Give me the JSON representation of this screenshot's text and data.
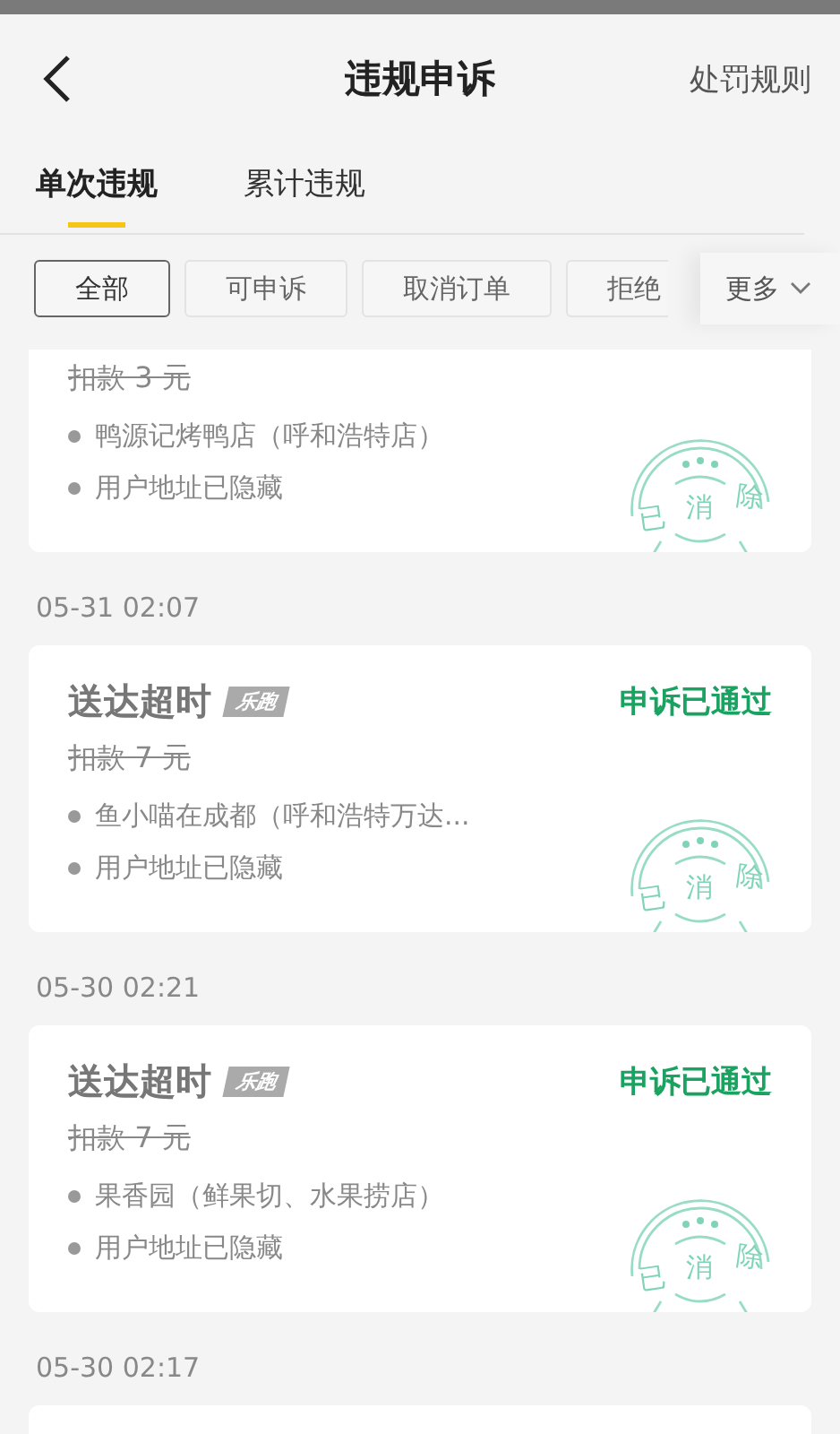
{
  "header": {
    "title": "违规申诉",
    "action": "处罚规则"
  },
  "tabs": [
    {
      "label": "单次违规",
      "selected": true
    },
    {
      "label": "累计违规",
      "selected": false
    }
  ],
  "filters": [
    {
      "label": "全部",
      "selected": true
    },
    {
      "label": "可申诉",
      "selected": false
    },
    {
      "label": "取消订单",
      "selected": false
    },
    {
      "label": "拒绝",
      "selected": false
    }
  ],
  "more": "更多",
  "records": [
    {
      "kind": "partial",
      "fine": "扣款 3 元",
      "shop": "鸭源记烤鸭店（呼和浩特店）",
      "address": "用户地址已隐藏",
      "stamp": "已消除"
    },
    {
      "kind": "full",
      "date": "05-31 02:07",
      "title": "送达超时",
      "tag": "乐跑",
      "status": "申诉已通过",
      "fine": "扣款 7 元",
      "shop": "鱼小喵在成都（呼和浩特万达...",
      "address": "用户地址已隐藏",
      "stamp": "已消除"
    },
    {
      "kind": "full",
      "date": "05-30 02:21",
      "title": "送达超时",
      "tag": "乐跑",
      "status": "申诉已通过",
      "fine": "扣款 7 元",
      "shop": "果香园（鲜果切、水果捞店）",
      "address": "用户地址已隐藏",
      "stamp": "已消除"
    },
    {
      "kind": "stub",
      "date": "05-30 02:17"
    }
  ]
}
